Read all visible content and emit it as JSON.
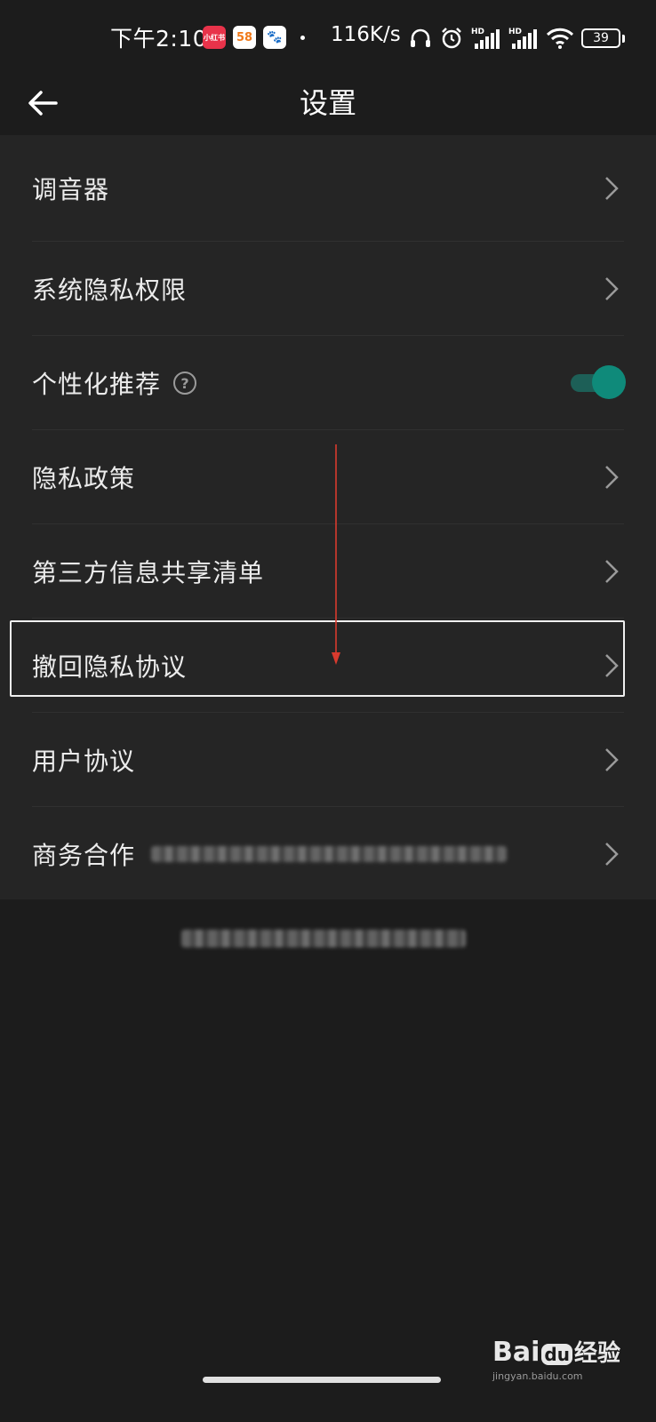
{
  "status_bar": {
    "time": "下午2:10",
    "app_icons": [
      {
        "name": "xiaohongshu-icon",
        "text": "小红书"
      },
      {
        "name": "58-icon",
        "text": "58"
      },
      {
        "name": "baidu-paw-icon",
        "text": "🐾"
      }
    ],
    "network_speed": "116K/s",
    "signal_labels": [
      "HD",
      "HD"
    ],
    "battery": "39"
  },
  "header": {
    "title": "设置"
  },
  "settings": {
    "items": [
      {
        "label": "调音器",
        "control": "chevron"
      },
      {
        "label": "系统隐私权限",
        "control": "chevron"
      },
      {
        "label": "个性化推荐",
        "control": "toggle",
        "toggle_on": true
      },
      {
        "label": "隐私政策",
        "control": "chevron"
      },
      {
        "label": "第三方信息共享清单",
        "control": "chevron"
      },
      {
        "label": "撤回隐私协议",
        "control": "chevron",
        "highlighted": true
      },
      {
        "label": "用户协议",
        "control": "chevron"
      },
      {
        "label": "商务合作",
        "control": "chevron"
      }
    ]
  },
  "watermark": {
    "brand": "Bai",
    "brand_mid": "du",
    "brand_suffix": "经验",
    "sub": "jingyan.baidu.com"
  },
  "colors": {
    "background": "#1c1c1c",
    "card": "#252525",
    "toggle_on": "#0f8a7a",
    "annotation_arrow": "#d83a2e"
  }
}
